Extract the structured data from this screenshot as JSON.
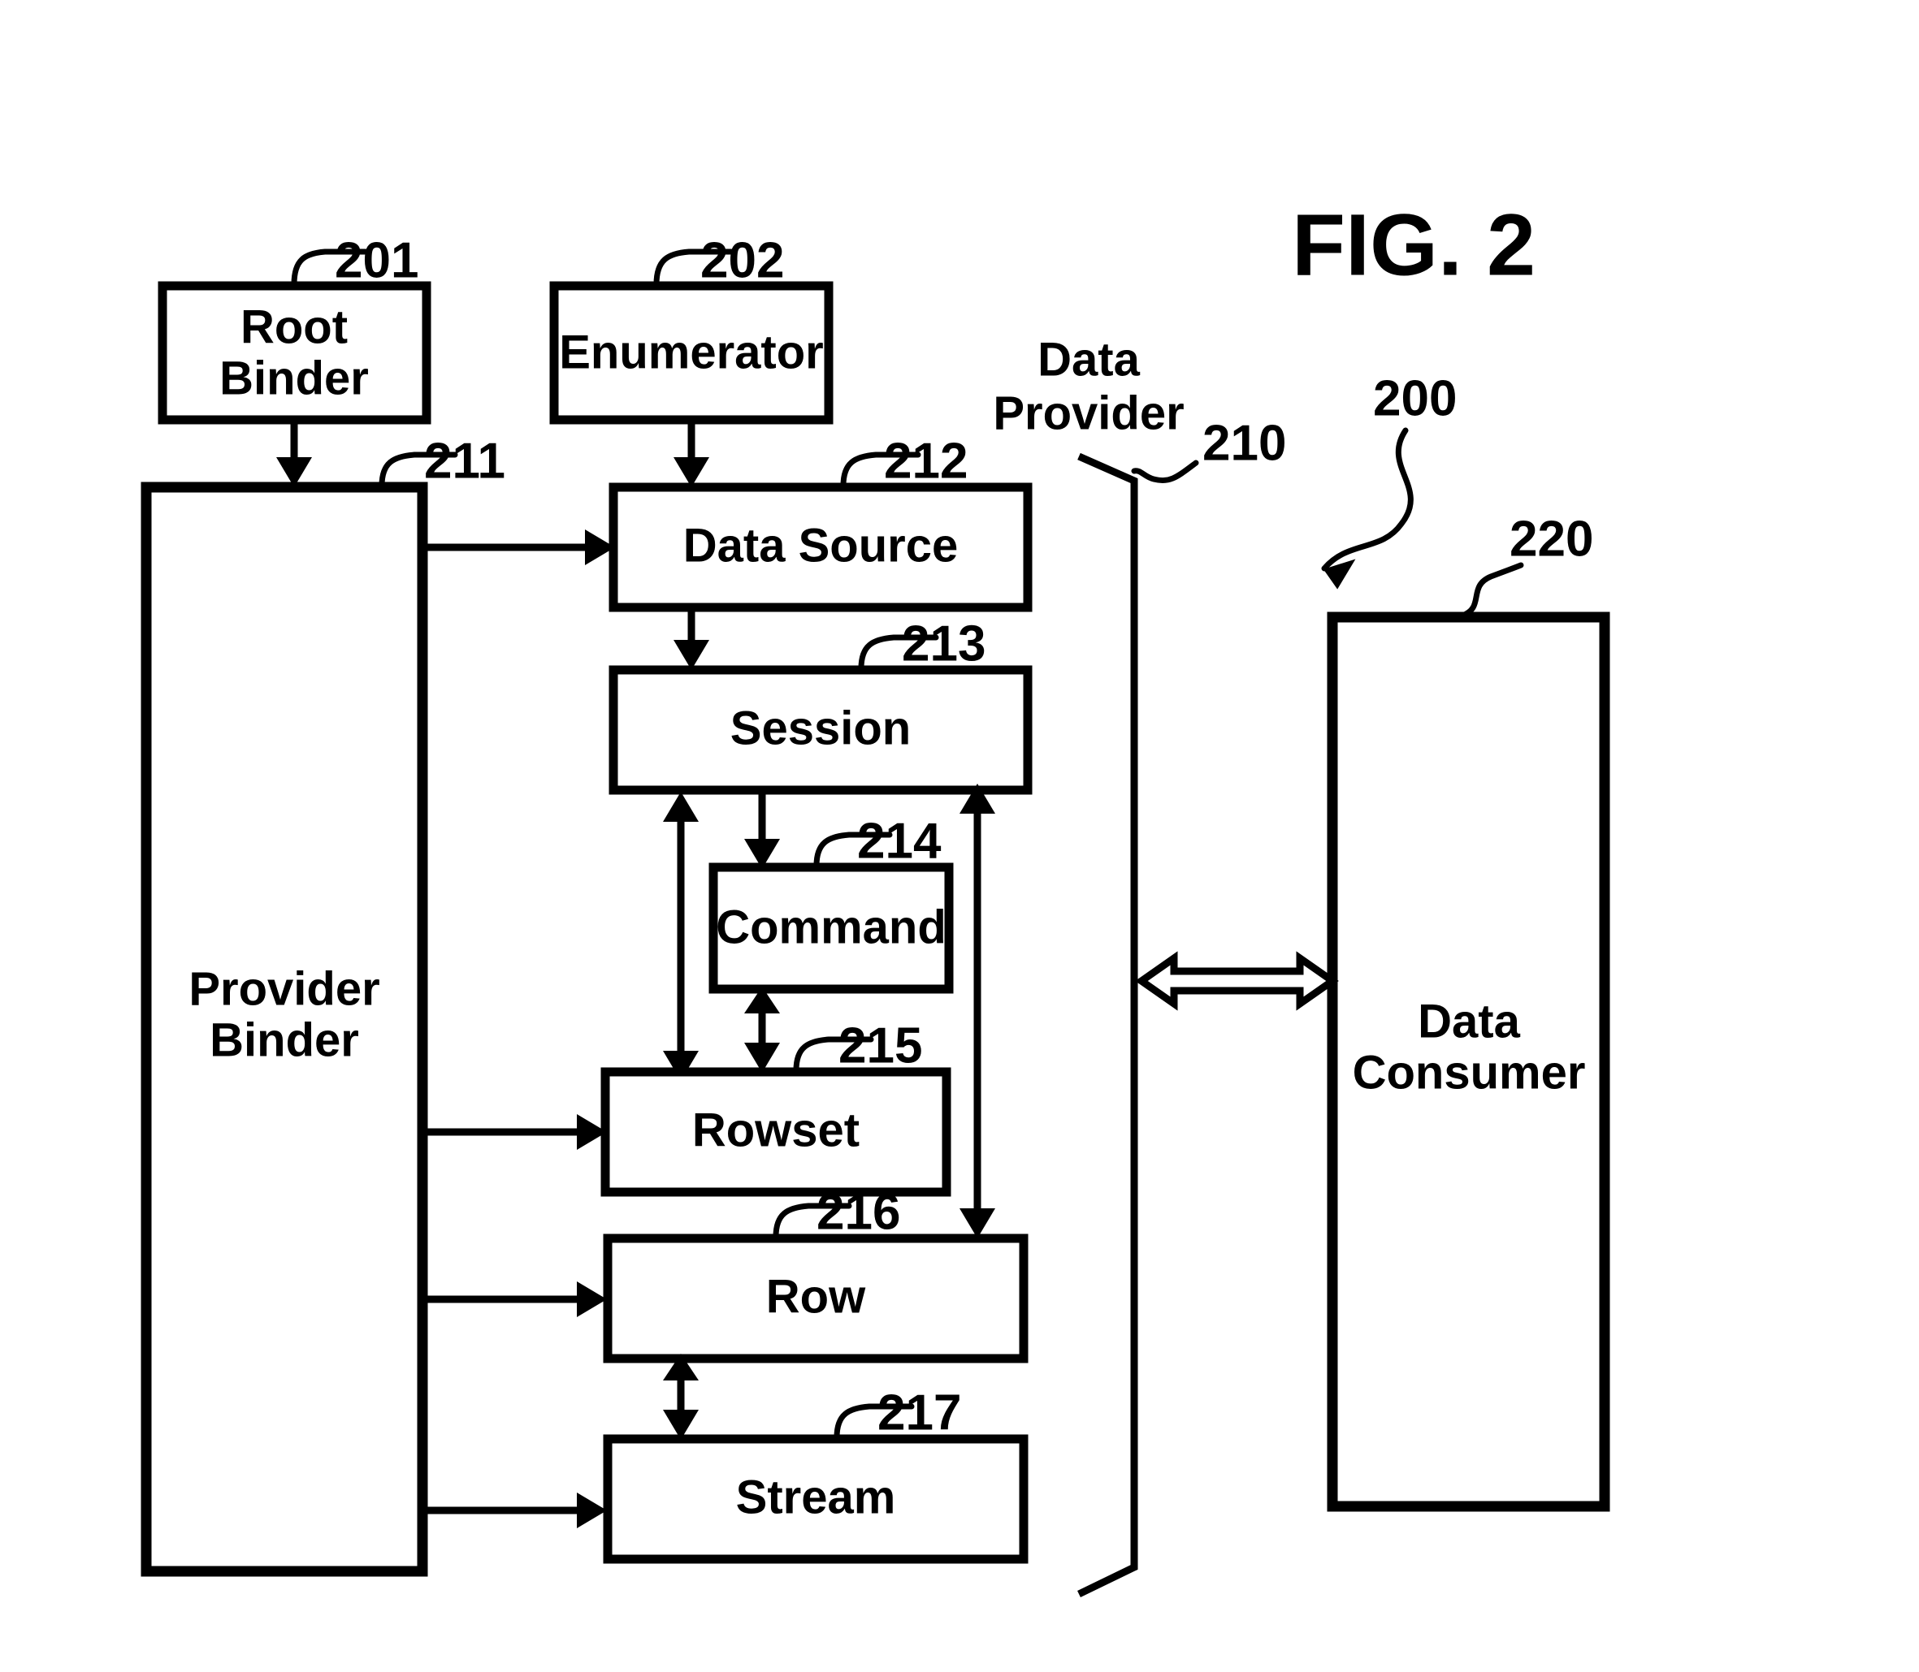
{
  "figure": {
    "title": "FIG. 2",
    "system_ref": "200"
  },
  "regions": {
    "data_provider": {
      "label_line1": "Data",
      "label_line2": "Provider",
      "ref": "210"
    }
  },
  "blocks": [
    {
      "id": "root-binder",
      "label_line1": "Root",
      "label_line2": "Binder",
      "ref": "201"
    },
    {
      "id": "enumerator",
      "label_line1": "Enumerator",
      "label_line2": "",
      "ref": "202"
    },
    {
      "id": "provider-binder",
      "label_line1": "Provider",
      "label_line2": "Binder",
      "ref": "211"
    },
    {
      "id": "data-source",
      "label_line1": "Data Source",
      "label_line2": "",
      "ref": "212"
    },
    {
      "id": "session",
      "label_line1": "Session",
      "label_line2": "",
      "ref": "213"
    },
    {
      "id": "command",
      "label_line1": "Command",
      "label_line2": "",
      "ref": "214"
    },
    {
      "id": "rowset",
      "label_line1": "Rowset",
      "label_line2": "",
      "ref": "215"
    },
    {
      "id": "row",
      "label_line1": "Row",
      "label_line2": "",
      "ref": "216"
    },
    {
      "id": "stream",
      "label_line1": "Stream",
      "label_line2": "",
      "ref": "217"
    },
    {
      "id": "data-consumer",
      "label_line1": "Data",
      "label_line2": "Consumer",
      "ref": "220"
    }
  ],
  "colors": {
    "ink": "#000000",
    "paper": "#ffffff"
  }
}
